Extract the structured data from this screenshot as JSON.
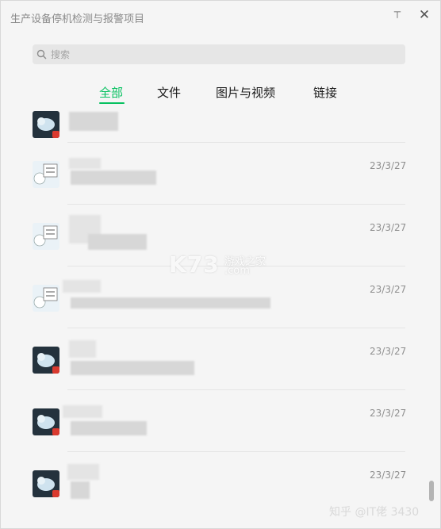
{
  "window": {
    "title": "生产设备停机检测与报警项目",
    "pin_glyph": "⊤",
    "close_glyph": "✕"
  },
  "search": {
    "placeholder": "搜索"
  },
  "tabs": [
    {
      "label": "全部",
      "active": true
    },
    {
      "label": "文件",
      "active": false
    },
    {
      "label": "图片与视频",
      "active": false
    },
    {
      "label": "链接",
      "active": false
    }
  ],
  "items": [
    {
      "date": "",
      "avatar": "cat"
    },
    {
      "date": "23/3/27",
      "avatar": "meme"
    },
    {
      "date": "23/3/27",
      "avatar": "meme"
    },
    {
      "date": "23/3/27",
      "avatar": "meme"
    },
    {
      "date": "23/3/27",
      "avatar": "cat"
    },
    {
      "date": "23/3/27",
      "avatar": "cat"
    },
    {
      "date": "23/3/27",
      "avatar": "cat"
    }
  ],
  "watermark": {
    "brand": "K73",
    "site": "游戏之家",
    "domain": ".com"
  },
  "credit": "知乎 @IT佬 3430",
  "colors": {
    "accent": "#07c160",
    "badge": "#d93a2f"
  }
}
